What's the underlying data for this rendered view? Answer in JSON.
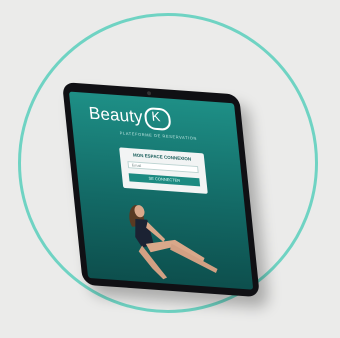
{
  "brand": {
    "name": "Beauty",
    "mark": "K"
  },
  "tagline": "PLATEFORME DE RESERVATION",
  "login": {
    "title": "MON ESPACE CONNEXION",
    "field_label": "Email",
    "button_label": "SE CONNECTER"
  },
  "colors": {
    "accent": "#6fd3c3",
    "screen_top": "#1e8f86",
    "screen_bottom": "#0d4f4d",
    "bezel": "#101014"
  }
}
